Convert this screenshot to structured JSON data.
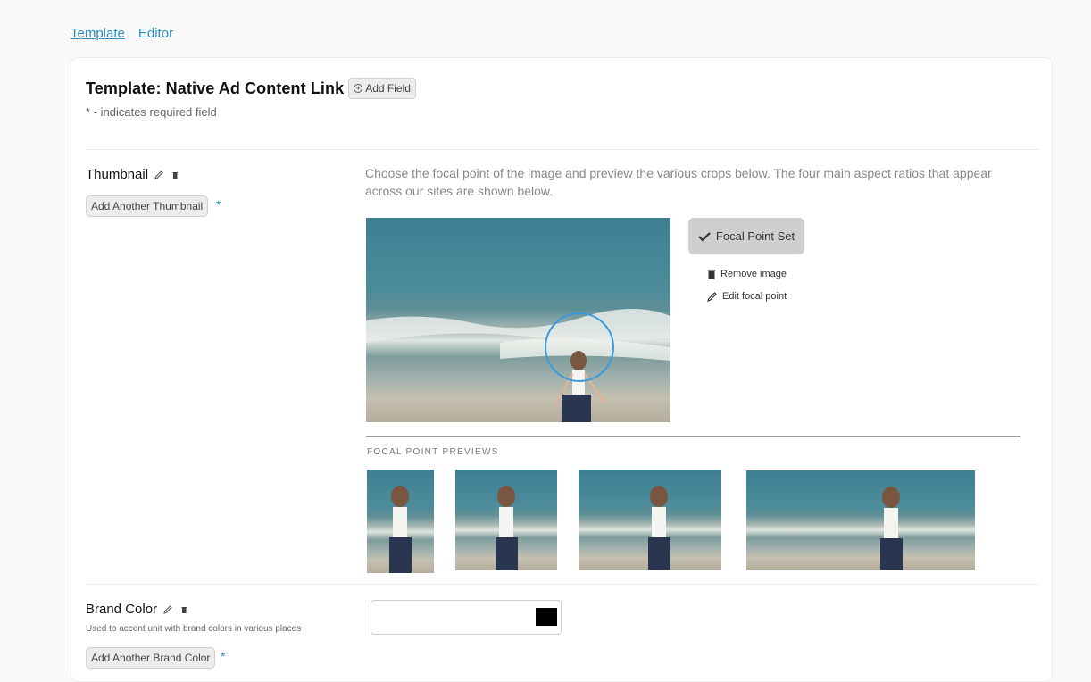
{
  "tabs": [
    {
      "label": "Template",
      "active": true
    },
    {
      "label": "Editor",
      "active": false
    }
  ],
  "template": {
    "title": "Template: Native Ad Content Link",
    "add_field_label": "Add Field",
    "required_note": "* - indicates required field"
  },
  "thumbnail": {
    "label": "Thumbnail",
    "add_another_label": "Add Another Thumbnail",
    "required_marker": "*",
    "description": "Choose the focal point of the image and preview the various crops below. The four main aspect ratios that appear across our sites are shown below.",
    "focal_point_button": "Focal Point Set",
    "remove_image_label": "Remove image",
    "edit_focal_label": "Edit focal point",
    "previews_title": "FOCAL POINT PREVIEWS"
  },
  "brand_color": {
    "label": "Brand Color",
    "description": "Used to accent unit with brand colors in various places",
    "add_another_label": "Add Another Brand Color",
    "required_marker": "*",
    "value_color": "#000000"
  },
  "colors": {
    "accent": "#2a8fc6",
    "focal_circle": "#3a9ad9"
  },
  "icons": [
    "pencil-icon",
    "trash-icon",
    "plus-circle-icon",
    "checkmark-icon"
  ]
}
